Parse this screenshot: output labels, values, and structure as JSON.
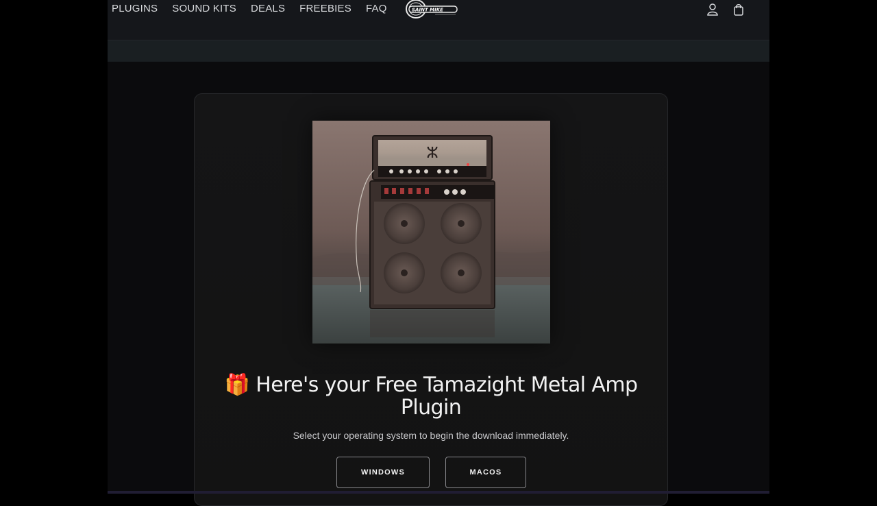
{
  "nav": {
    "items": [
      {
        "label": "PLUGINS"
      },
      {
        "label": "SOUND KITS"
      },
      {
        "label": "DEALS"
      },
      {
        "label": "FREEBIES"
      },
      {
        "label": "FAQ"
      }
    ]
  },
  "logo": {
    "text": "SAINT MIKE"
  },
  "header_icons": [
    "account-icon",
    "cart-icon"
  ],
  "main": {
    "emoji": "🎁",
    "headline": "Here's your Free Tamazight Metal Amp Plugin",
    "subtitle": "Select your operating system to begin the download immediately.",
    "buttons": {
      "windows": "WINDOWS",
      "macos": "MACOS"
    }
  },
  "colors": {
    "page_bg": "#000000",
    "header_bg": "#15171b",
    "card_bg": "#151516",
    "text": "#f2f2f2"
  }
}
